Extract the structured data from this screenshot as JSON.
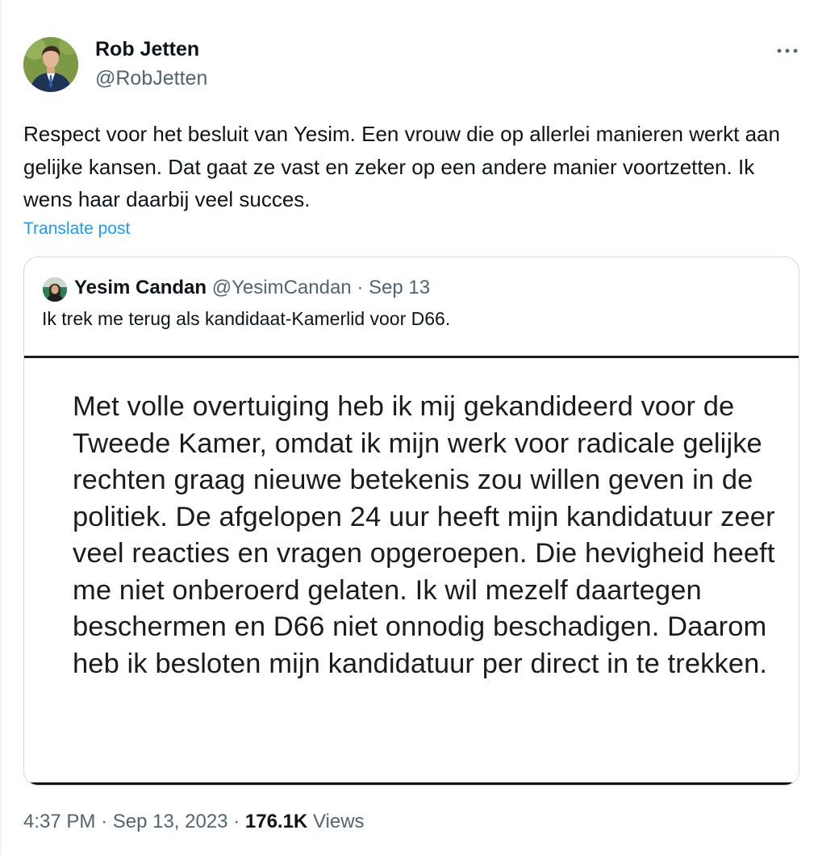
{
  "author": {
    "name": "Rob Jetten",
    "handle": "@RobJetten",
    "avatar_icon": "profile-photo"
  },
  "more_icon": "more-horizontal-icon",
  "tweet": {
    "text": "Respect voor het besluit van Yesim. Een vrouw die op allerlei manieren werkt aan gelijke kansen. Dat gaat ze vast en zeker op een andere manier voortzetten. Ik wens haar daarbij veel succes.",
    "translate_label": "Translate post"
  },
  "quote": {
    "name": "Yesim Candan",
    "handle": "@YesimCandan",
    "separator": "·",
    "date": "Sep 13",
    "text": "Ik trek me terug als kandidaat-Kamerlid voor D66.",
    "image_text": "Met volle overtuiging heb ik mij gekandideerd voor de Tweede Kamer, omdat ik mijn werk voor radicale gelijke rechten graag nieuwe betekenis zou willen geven in de politiek. De afgelopen 24 uur heeft mijn kandidatuur zeer veel reacties en vragen opgeroepen. Die hevigheid heeft me niet onberoerd gelaten. Ik wil mezelf daartegen beschermen en D66 niet onnodig beschadigen. Daarom heb ik besloten mijn kandidatuur per direct in te trekken."
  },
  "meta": {
    "time": "4:37 PM",
    "separator": "·",
    "date": "Sep 13, 2023",
    "views_count": "176.1K",
    "views_label": "Views"
  },
  "colors": {
    "text_primary": "#0f1419",
    "text_secondary": "#536471",
    "link": "#1d9bf0",
    "border": "#cfd9de"
  }
}
